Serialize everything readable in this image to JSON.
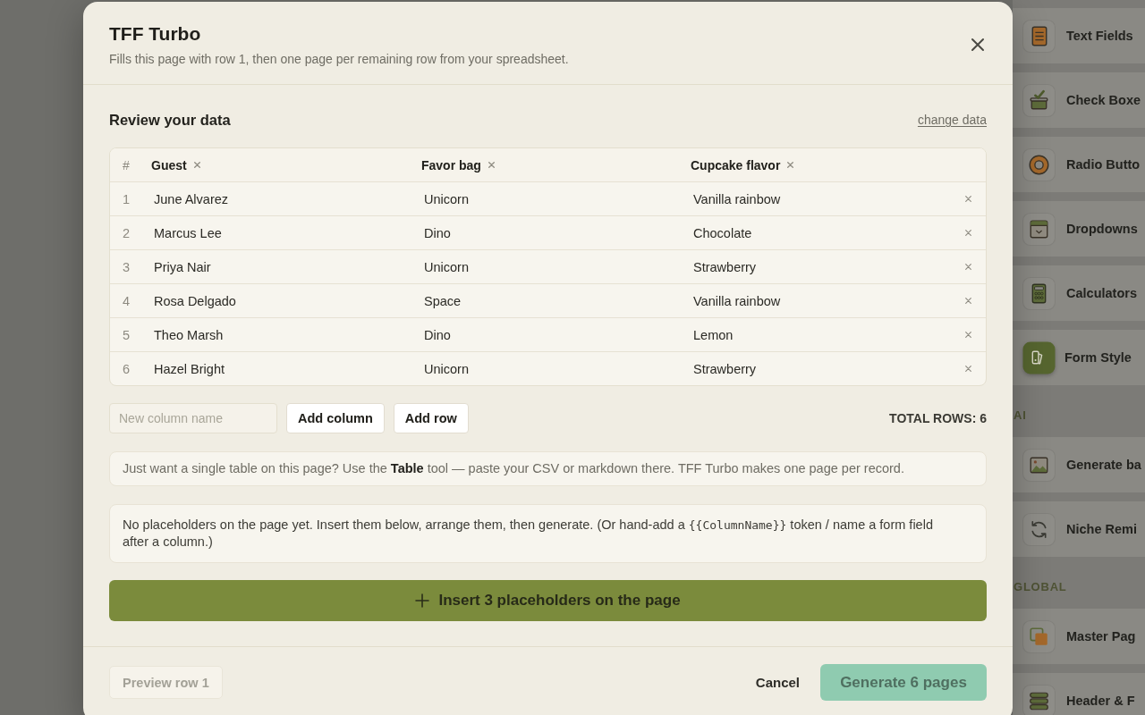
{
  "dialog": {
    "title": "TFF Turbo",
    "subtitle": "Fills this page with row 1, then one page per remaining row from your spreadsheet."
  },
  "review": {
    "heading": "Review your data",
    "link": "change data"
  },
  "table": {
    "index_label": "#",
    "columns": [
      "Guest",
      "Favor bag",
      "Cupcake flavor"
    ],
    "rows": [
      {
        "number": "1",
        "cells": [
          "June Alvarez",
          "Unicorn",
          "Vanilla rainbow"
        ]
      },
      {
        "number": "2",
        "cells": [
          "Marcus Lee",
          "Dino",
          "Chocolate"
        ]
      },
      {
        "number": "3",
        "cells": [
          "Priya Nair",
          "Unicorn",
          "Strawberry"
        ]
      },
      {
        "number": "4",
        "cells": [
          "Rosa Delgado",
          "Space",
          "Vanilla rainbow"
        ]
      },
      {
        "number": "5",
        "cells": [
          "Theo Marsh",
          "Dino",
          "Lemon"
        ]
      },
      {
        "number": "6",
        "cells": [
          "Hazel Bright",
          "Unicorn",
          "Strawberry"
        ]
      }
    ]
  },
  "column_tools": {
    "placeholder": "New column name",
    "add_column": "Add column",
    "add_row": "Add row",
    "total": "TOTAL ROWS: 6"
  },
  "tip": "Just want a single table on this page? Use the **Table** tool — paste your CSV or markdown there. TFF Turbo makes one page per record.",
  "status_note": {
    "before": "No placeholders on the page yet. Insert them below, arrange them, then generate. (Or hand-add a ",
    "token": "{{ColumnName}}",
    "after": " token / name a form field after a column.)"
  },
  "insert_button": "Insert 3 placeholders on the page",
  "footer": {
    "buttons": [
      {
        "kind": "secondary",
        "label": "Preview row 1",
        "disabled": true
      },
      {
        "kind": "plain",
        "label": "Cancel",
        "disabled": false
      },
      {
        "kind": "primary",
        "label": "Generate 6 pages",
        "disabled": true
      }
    ]
  },
  "sidebar": {
    "sections": [
      {
        "items": [
          {
            "kind": "textfield",
            "label": "Text Fields",
            "selected": false
          },
          {
            "kind": "checkbox",
            "label": "Check Boxe",
            "selected": false
          },
          {
            "kind": "radio",
            "label": "Radio Butto",
            "selected": false
          },
          {
            "kind": "dropdown",
            "label": "Dropdowns",
            "selected": false
          },
          {
            "kind": "calculator",
            "label": "Calculators",
            "selected": false
          },
          {
            "kind": "style",
            "label": "Form Style",
            "selected": true
          }
        ]
      },
      {
        "heading": "AI",
        "items": [
          {
            "kind": "image",
            "label": "Generate ba",
            "selected": false
          },
          {
            "kind": "remix",
            "label": "Niche Remi",
            "selected": false
          }
        ]
      },
      {
        "heading": "GLOBAL",
        "items": [
          {
            "kind": "master",
            "label": "Master Pag",
            "selected": false
          },
          {
            "kind": "headerfooter",
            "label": "Header & F",
            "selected": false
          }
        ]
      }
    ]
  }
}
